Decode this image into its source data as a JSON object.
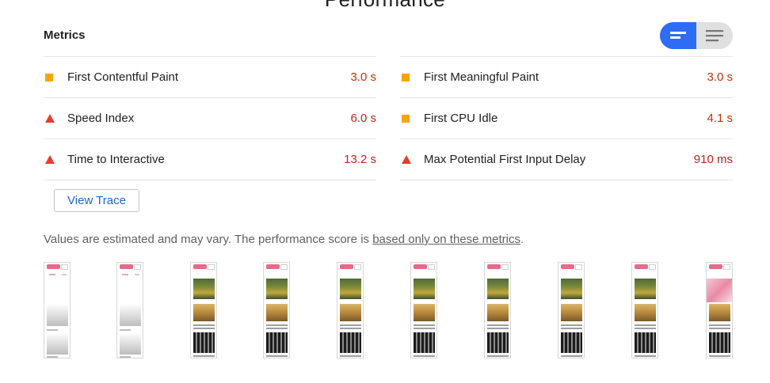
{
  "section": {
    "title": "Performance"
  },
  "metrics": {
    "title": "Metrics",
    "toggle": {
      "expanded_icon": "expanded-view-icon",
      "collapsed_icon": "list-view-icon",
      "active_color": "#2e6cf6"
    },
    "left": [
      {
        "label": "First Contentful Paint",
        "value": "3.0 s",
        "status": "average",
        "icon": "square-icon"
      },
      {
        "label": "Speed Index",
        "value": "6.0 s",
        "status": "fail",
        "icon": "triangle-icon"
      },
      {
        "label": "Time to Interactive",
        "value": "13.2 s",
        "status": "fail",
        "icon": "triangle-icon"
      }
    ],
    "right": [
      {
        "label": "First Meaningful Paint",
        "value": "3.0 s",
        "status": "average",
        "icon": "square-icon"
      },
      {
        "label": "First CPU Idle",
        "value": "4.1 s",
        "status": "average",
        "icon": "square-icon"
      },
      {
        "label": "Max Potential First Input Delay",
        "value": "910 ms",
        "status": "fail",
        "icon": "triangle-icon"
      }
    ]
  },
  "view_trace": {
    "label": "View Trace"
  },
  "disclaimer": {
    "text_before": "Values are estimated and may vary. The performance score is ",
    "link_text": "based only on these metrics",
    "text_after": "."
  },
  "filmstrip": {
    "frame_count": 10
  },
  "colors": {
    "average": "#f7a500",
    "fail": "#eb3b2f",
    "link": "#2264d6"
  }
}
